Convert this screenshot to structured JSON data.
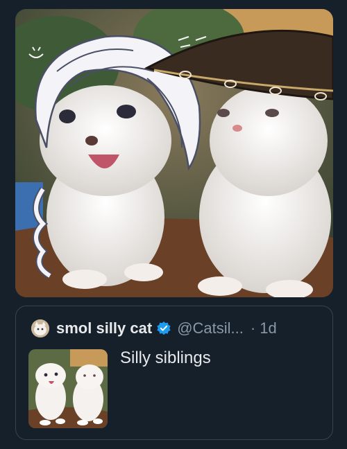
{
  "media": {
    "image_icon": "cat-photo-image",
    "alt_description": ""
  },
  "quote": {
    "author_name": "smol silly cat",
    "handle": "@Catsil...",
    "separator": "·",
    "time": "1d",
    "text": "Silly siblings",
    "verified": true,
    "accent_color": "#1d9bf0"
  },
  "colors": {
    "background": "#15202b",
    "border": "#38444d",
    "muted_text": "#8b98a5",
    "primary_text": "#e7e9ea"
  }
}
